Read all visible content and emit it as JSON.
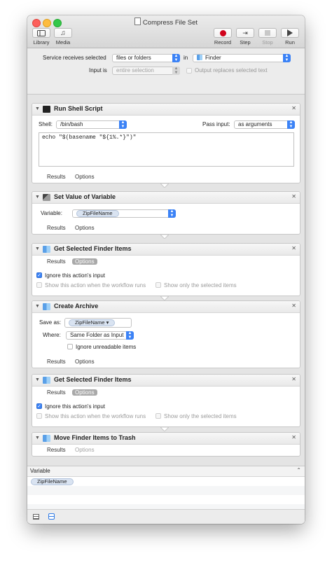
{
  "window": {
    "title": "Compress File Set"
  },
  "toolbar": {
    "library_label": "Library",
    "media_label": "Media",
    "record_label": "Record",
    "step_label": "Step",
    "stop_label": "Stop",
    "run_label": "Run"
  },
  "service": {
    "receives_label": "Service receives selected",
    "receives_value": "files or folders",
    "in_label": "in",
    "app_value": "Finder",
    "input_is_label": "Input is",
    "input_is_value": "entire selection",
    "replace_label": "Output replaces selected text"
  },
  "actions": {
    "shell": {
      "title": "Run Shell Script",
      "shell_label": "Shell:",
      "shell_value": "/bin/bash",
      "pass_label": "Pass input:",
      "pass_value": "as arguments",
      "script": "echo \"$(basename \"${1%.*}\")\"",
      "results": "Results",
      "options": "Options"
    },
    "setvar": {
      "title": "Set Value of Variable",
      "variable_label": "Variable:",
      "variable_value": "ZipFileName",
      "results": "Results",
      "options": "Options"
    },
    "getitems1": {
      "title": "Get Selected Finder Items",
      "results": "Results",
      "options": "Options",
      "ignore_label": "Ignore this action's input",
      "show_label": "Show this action when the workflow runs",
      "only_label": "Show only the selected items"
    },
    "archive": {
      "title": "Create Archive",
      "save_as_label": "Save as:",
      "save_as_value": "ZipFileName",
      "where_label": "Where:",
      "where_value": "Same Folder as Input",
      "ignore_unreadable_label": "Ignore unreadable items",
      "results": "Results",
      "options": "Options"
    },
    "getitems2": {
      "title": "Get Selected Finder Items",
      "results": "Results",
      "options": "Options",
      "ignore_label": "Ignore this action's input",
      "show_label": "Show this action when the workflow runs",
      "only_label": "Show only the selected items"
    },
    "trash": {
      "title": "Move Finder Items to Trash",
      "results": "Results",
      "options": "Options"
    }
  },
  "variables_panel": {
    "header": "Variable",
    "items": [
      "ZipFileName"
    ]
  },
  "colors": {
    "accent": "#3b82f6",
    "record": "#d0021b"
  }
}
